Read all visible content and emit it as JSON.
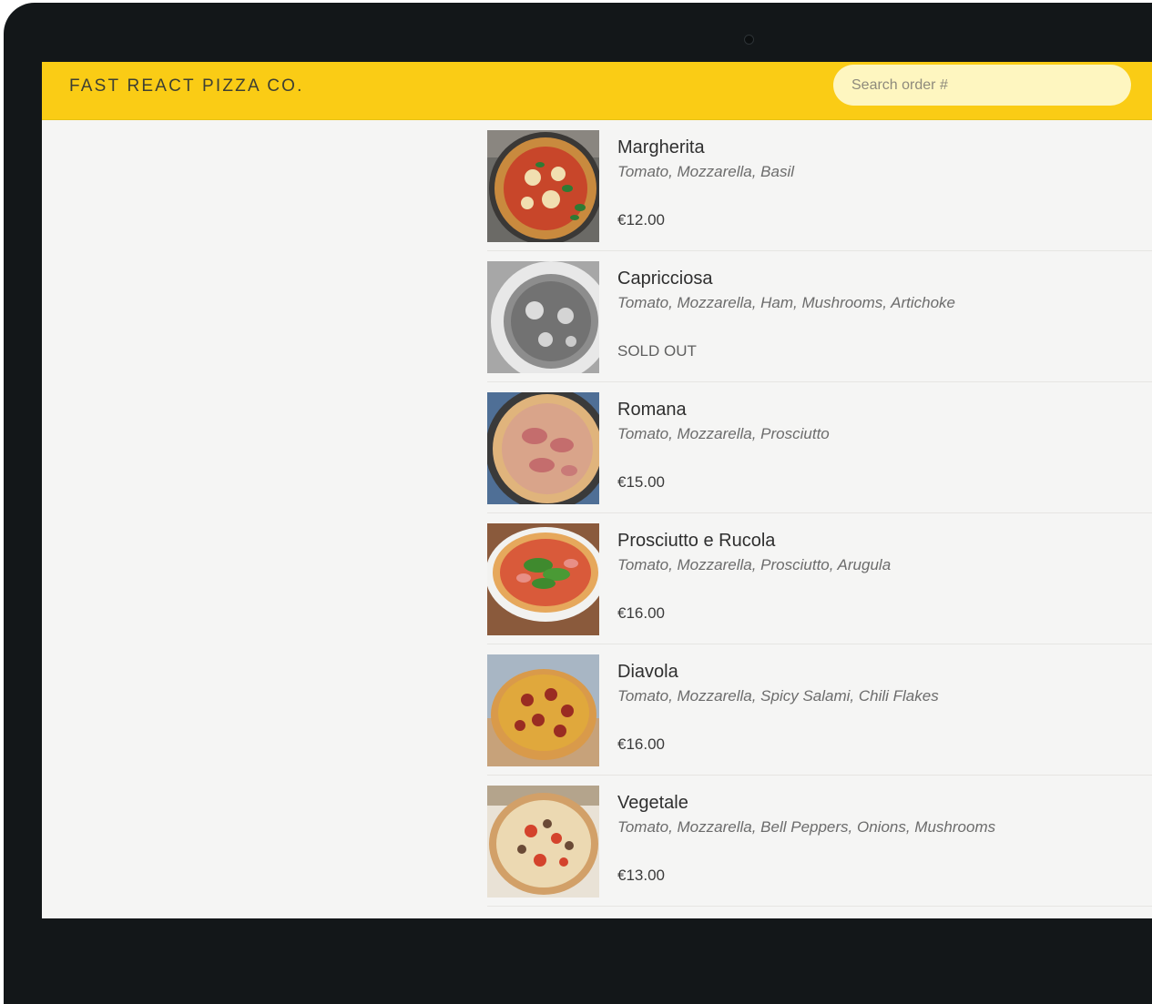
{
  "header": {
    "logo": "FAST REACT PIZZA CO.",
    "search_placeholder": "Search order #"
  },
  "menu": {
    "items": [
      {
        "name": "Margherita",
        "ingredients": "Tomato, Mozzarella, Basil",
        "price": "€12.00",
        "sold_out": false
      },
      {
        "name": "Capricciosa",
        "ingredients": "Tomato, Mozzarella, Ham, Mushrooms, Artichoke",
        "status": "SOLD OUT",
        "sold_out": true
      },
      {
        "name": "Romana",
        "ingredients": "Tomato, Mozzarella, Prosciutto",
        "price": "€15.00",
        "sold_out": false
      },
      {
        "name": "Prosciutto e Rucola",
        "ingredients": "Tomato, Mozzarella, Prosciutto, Arugula",
        "price": "€16.00",
        "sold_out": false
      },
      {
        "name": "Diavola",
        "ingredients": "Tomato, Mozzarella, Spicy Salami, Chili Flakes",
        "price": "€16.00",
        "sold_out": false
      },
      {
        "name": "Vegetale",
        "ingredients": "Tomato, Mozzarella, Bell Peppers, Onions, Mushrooms",
        "price": "€13.00",
        "sold_out": false
      }
    ]
  },
  "colors": {
    "header_bg": "#facc15",
    "search_bg": "#fef6c0",
    "page_bg": "#f5f5f4",
    "device_frame": "#131719"
  }
}
